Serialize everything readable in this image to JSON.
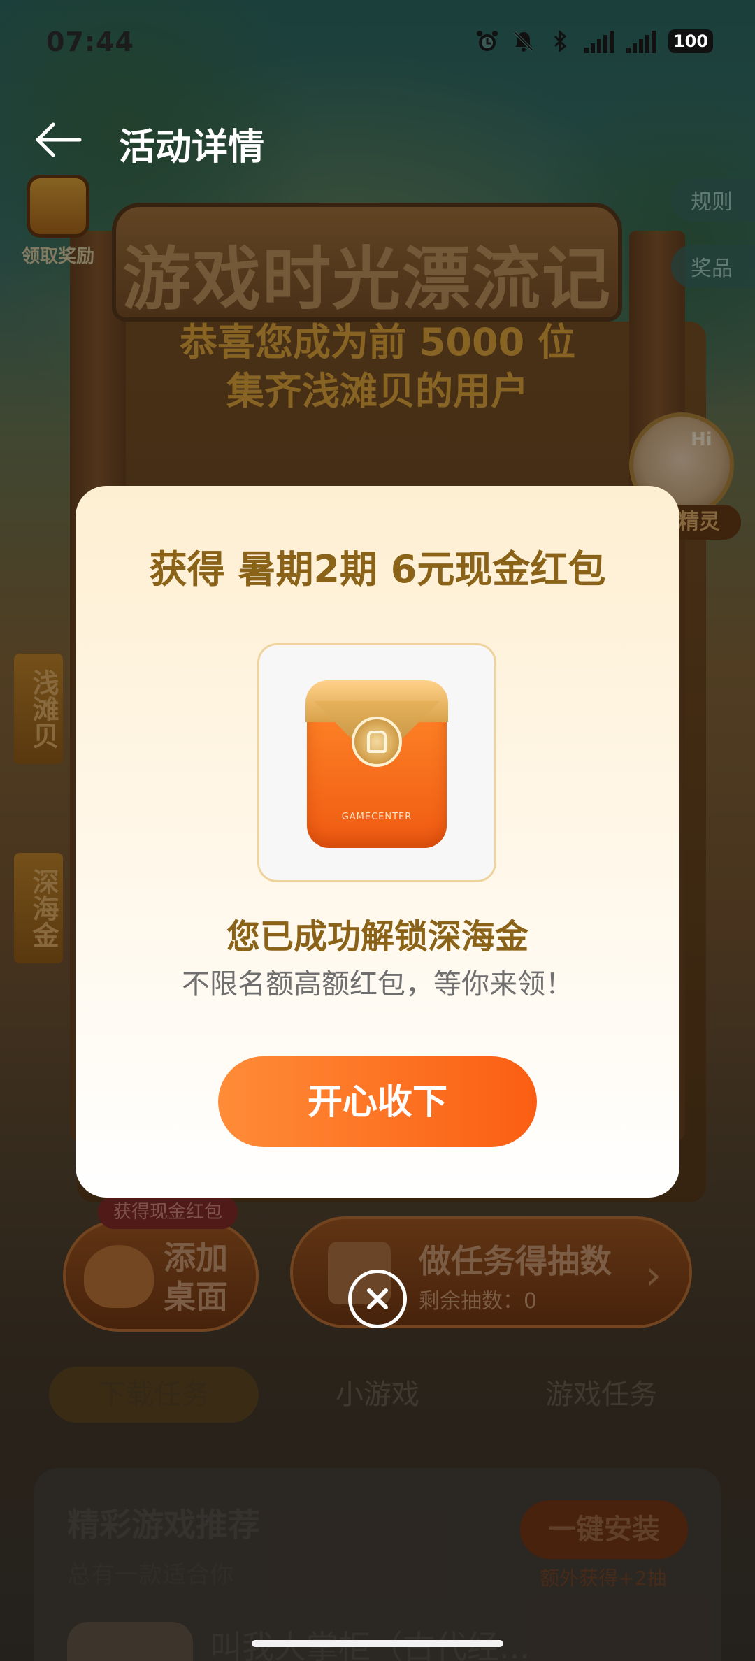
{
  "status_bar": {
    "time": "07:44",
    "battery": "100",
    "icons": [
      "alarm-icon",
      "mute-icon",
      "bluetooth-icon",
      "signal-5g-a-icon",
      "signal-5g-icon",
      "battery-icon"
    ]
  },
  "header": {
    "title": "活动详情",
    "back_icon": "arrow-left-icon"
  },
  "background": {
    "banner_title": "游戏时光漂流记",
    "reward_label": "领取奖励",
    "side_tabs": [
      "规则",
      "奖品"
    ],
    "spirit_label": "精灵",
    "spirit_greeting": "Hi",
    "vertical_tags": [
      "浅滩贝",
      "深海金"
    ],
    "congrats_line1": "恭喜您成为前 5000 位",
    "congrats_line2": "集齐浅滩贝的用户",
    "gain_tag": "获得现金红包",
    "add_desktop": "添加桌面",
    "task_title": "做任务得抽数",
    "task_remaining": "剩余抽数：0",
    "tabs": [
      "下载任务",
      "小游戏",
      "游戏任务"
    ],
    "active_tab": "下载任务",
    "recommend_title": "精彩游戏推荐",
    "recommend_sub": "总有一款适合你",
    "install_button": "一键安装",
    "install_bonus": "额外获得+2抽",
    "game_name": "叫我大掌柜（古代经..."
  },
  "modal": {
    "title": "获得 暑期2期 6元现金红包",
    "prize_image_brand": "GAMECENTER",
    "unlock_title": "您已成功解锁深海金",
    "unlock_sub": "不限名额高额红包，等你来领！",
    "accept_button": "开心收下",
    "close_icon": "close-circle-icon"
  },
  "colors": {
    "accent_orange": "#fb5e12",
    "gold_text": "#8a6318",
    "congrats_gold": "#e8ad3e"
  }
}
